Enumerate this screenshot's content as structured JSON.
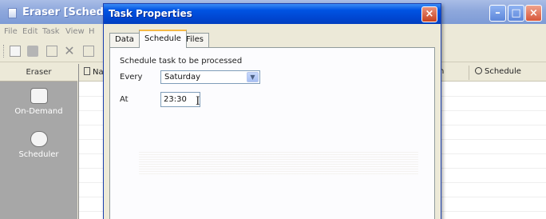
{
  "main_window": {
    "title": "Eraser  [Scheduler",
    "menu": [
      "File",
      "Edit",
      "Task",
      "View",
      "H"
    ],
    "left_pane": {
      "header": "Eraser",
      "items": [
        {
          "label": "On-Demand",
          "icon": "on-demand-icon"
        },
        {
          "label": "Scheduler",
          "icon": "scheduler-icon"
        }
      ]
    },
    "list": {
      "columns": [
        "Na",
        "n",
        "Schedule"
      ]
    },
    "caption_buttons": {
      "minimize": "–",
      "maximize": "□",
      "close": "×"
    }
  },
  "dialog": {
    "title": "Task Properties",
    "close_glyph": "×",
    "tabs": [
      "Data",
      "Schedule",
      "Files"
    ],
    "active_tab": "Schedule",
    "schedule": {
      "section_label": "Schedule task to be processed",
      "every_label": "Every",
      "every_value": "Saturday",
      "at_label": "At",
      "at_value": "23:30"
    }
  },
  "colors": {
    "dialog_title": "#0054e3",
    "tab_highlight": "#f5b945",
    "main_title_inactive": "#8ea8dc"
  }
}
